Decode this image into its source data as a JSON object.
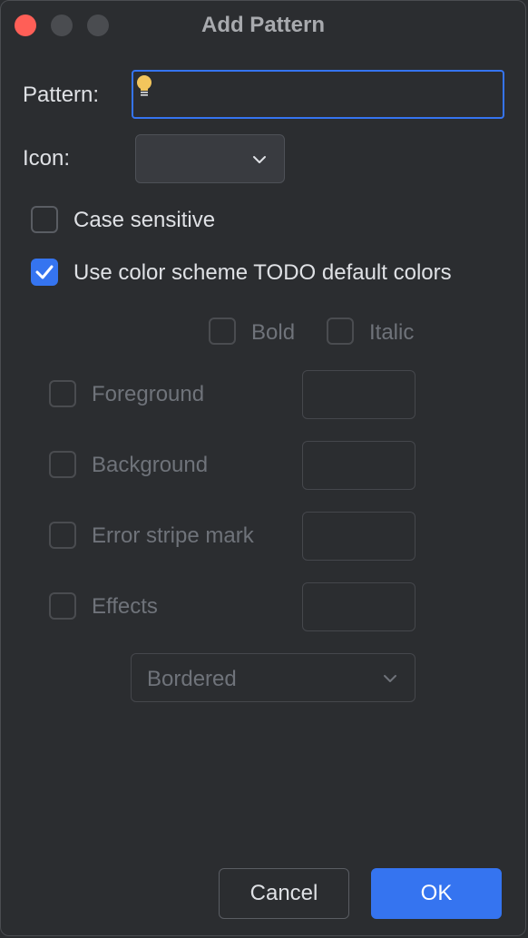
{
  "dialog": {
    "title": "Add Pattern"
  },
  "pattern": {
    "label": "Pattern:",
    "value": ""
  },
  "icon": {
    "label": "Icon:",
    "selected": ""
  },
  "options": {
    "case_sensitive": {
      "label": "Case sensitive",
      "checked": false
    },
    "use_color_scheme": {
      "label": "Use color scheme TODO default colors",
      "checked": true
    }
  },
  "style": {
    "bold": {
      "label": "Bold",
      "checked": false
    },
    "italic": {
      "label": "Italic",
      "checked": false
    }
  },
  "colors": {
    "foreground": {
      "label": "Foreground",
      "checked": false
    },
    "background": {
      "label": "Background",
      "checked": false
    },
    "error_stripe": {
      "label": "Error stripe mark",
      "checked": false
    },
    "effects": {
      "label": "Effects",
      "checked": false
    }
  },
  "effect_type": {
    "selected": "Bordered"
  },
  "buttons": {
    "cancel": "Cancel",
    "ok": "OK"
  },
  "theme": {
    "accent": "#3574f0",
    "close_dot": "#ff5f57",
    "background": "#2b2d30",
    "bulb": "#f2c55c"
  }
}
